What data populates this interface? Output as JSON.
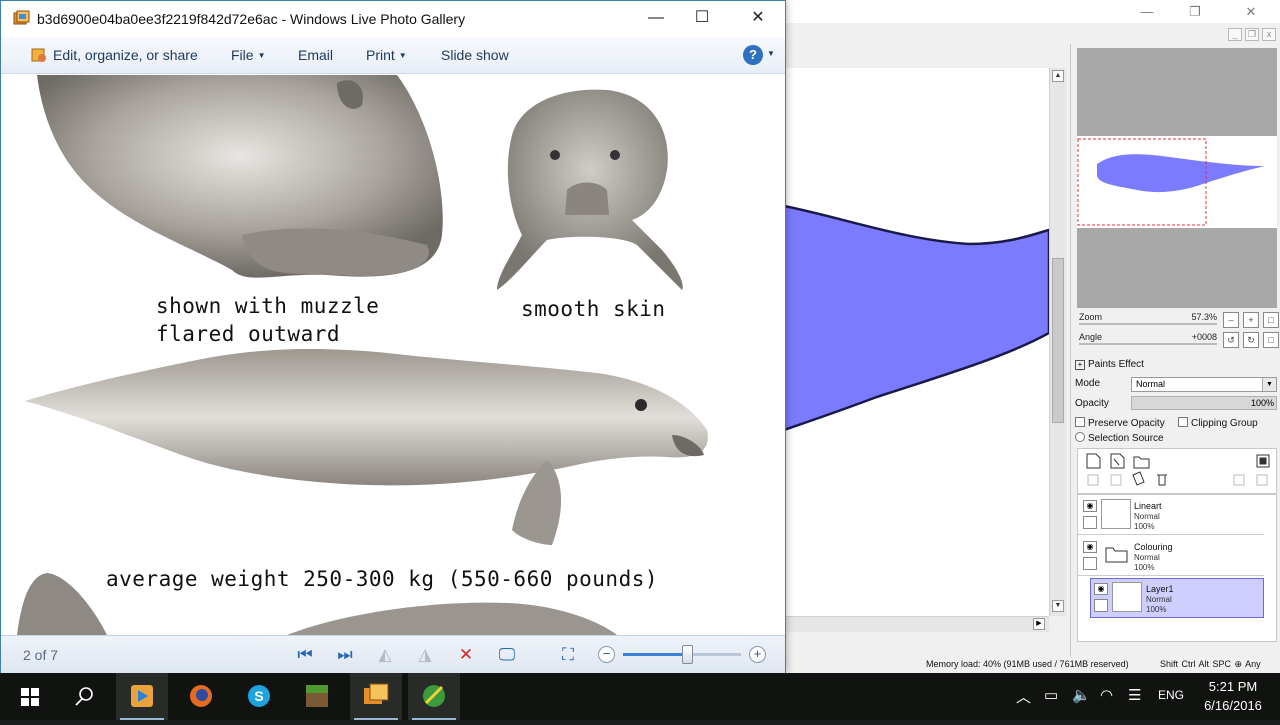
{
  "sai": {
    "navigator": {
      "zoom_label": "Zoom",
      "zoom_value": "57.3%",
      "angle_label": "Angle",
      "angle_value": "+0008"
    },
    "layer_props": {
      "paints_effect": "Paints Effect",
      "mode_label": "Mode",
      "mode_value": "Normal",
      "opacity_label": "Opacity",
      "opacity_value": "100%",
      "preserve_opacity": "Preserve Opacity",
      "clipping_group": "Clipping Group",
      "selection_source": "Selection Source"
    },
    "layers": [
      {
        "name": "Lineart",
        "mode": "Normal",
        "opacity": "100%"
      },
      {
        "name": "Colouring",
        "mode": "Normal",
        "opacity": "100%"
      },
      {
        "name": "Layer1",
        "mode": "Normal",
        "opacity": "100%"
      }
    ],
    "status": {
      "memory": "Memory load: 40% (91MB used / 761MB reserved)",
      "keys": "Shift Ctrl Alt SPC ⊕ Any"
    },
    "colors": {
      "manatee_fill": "#7b7bff",
      "selected_layer": "#cfcfff"
    }
  },
  "gallery": {
    "title": "b3d6900e04ba0ee3f2219f842d72e6ac - Windows Live Photo Gallery",
    "menu": {
      "edit": "Edit, organize, or share",
      "file": "File",
      "email": "Email",
      "print": "Print",
      "slideshow": "Slide show",
      "help": "?"
    },
    "captions": {
      "muzzle_line1": "shown with muzzle",
      "muzzle_line2": "flared outward",
      "skin": "smooth skin",
      "weight": "average weight 250-300 kg (550-660 pounds)"
    },
    "counter": "2 of 7",
    "zoom_level": 0.55
  },
  "taskbar": {
    "time": "5:21 PM",
    "date": "6/16/2016",
    "language": "ENG"
  }
}
